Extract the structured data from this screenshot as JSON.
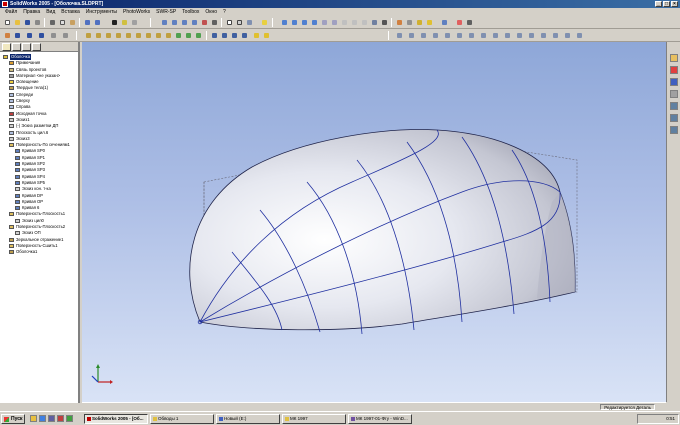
{
  "window": {
    "title": "SolidWorks 2005 - [Оболочка.SLDPRT]",
    "buttons": [
      "_",
      "□",
      "×"
    ]
  },
  "menu": [
    "Файл",
    "Правка",
    "Вид",
    "Вставка",
    "Инструменты",
    "PhotoWorks",
    "SWR-SP",
    "Toolbox",
    "Окно",
    "?"
  ],
  "tree": {
    "items": [
      {
        "label": "Оболочка",
        "indent": 0,
        "icon": "part-icon",
        "selected": true
      },
      {
        "label": "Примечания",
        "indent": 1,
        "icon": "annotations-icon"
      },
      {
        "label": "Связь проектов",
        "indent": 1,
        "icon": "design-binder-icon"
      },
      {
        "label": "Материал <не указан>",
        "indent": 1,
        "icon": "material-icon"
      },
      {
        "label": "Освещение",
        "indent": 1,
        "icon": "lighting-icon"
      },
      {
        "label": "Твердые тела(1)",
        "indent": 1,
        "icon": "solid-bodies-icon"
      },
      {
        "label": "Спереди",
        "indent": 1,
        "icon": "plane-icon"
      },
      {
        "label": "Сверху",
        "indent": 1,
        "icon": "plane-icon"
      },
      {
        "label": "Справа",
        "indent": 1,
        "icon": "plane-icon"
      },
      {
        "label": "Исходная точка",
        "indent": 1,
        "icon": "origin-icon"
      },
      {
        "label": "Эскиз1",
        "indent": 1,
        "icon": "sketch-icon"
      },
      {
        "label": "(-) Эскиз разметки ДП",
        "indent": 1,
        "icon": "sketch-icon"
      },
      {
        "label": "Плоскость цил.6",
        "indent": 1,
        "icon": "plane-icon"
      },
      {
        "label": "Эскиз3",
        "indent": 1,
        "icon": "sketch-icon"
      },
      {
        "label": "Поверхность-По сечениям1",
        "indent": 1,
        "icon": "surface-loft-icon"
      },
      {
        "label": "Кривая SP0",
        "indent": 2,
        "icon": "curve-icon"
      },
      {
        "label": "Кривая SP1",
        "indent": 2,
        "icon": "curve-icon"
      },
      {
        "label": "Кривая SP2",
        "indent": 2,
        "icon": "curve-icon"
      },
      {
        "label": "Кривая SP3",
        "indent": 2,
        "icon": "curve-icon"
      },
      {
        "label": "Кривая SP4",
        "indent": 2,
        "icon": "curve-icon"
      },
      {
        "label": "Кривая SP5",
        "indent": 2,
        "icon": "curve-icon"
      },
      {
        "label": "Эскиз кон. т-ка",
        "indent": 2,
        "icon": "sketch-icon"
      },
      {
        "label": "Кривая DP",
        "indent": 2,
        "icon": "curve-icon"
      },
      {
        "label": "Кривая OP",
        "indent": 2,
        "icon": "curve-icon"
      },
      {
        "label": "Кривая 6",
        "indent": 2,
        "icon": "curve-icon"
      },
      {
        "label": "Поверхность-Плоскость1",
        "indent": 1,
        "icon": "surface-plane-icon"
      },
      {
        "label": "Эскиз цил0",
        "indent": 2,
        "icon": "sketch-icon"
      },
      {
        "label": "Поверхность-Плоскость2",
        "indent": 1,
        "icon": "surface-plane-icon"
      },
      {
        "label": "Эскиз ОП",
        "indent": 2,
        "icon": "sketch-icon"
      },
      {
        "label": "Зеркальное отражение1",
        "indent": 1,
        "icon": "mirror-icon"
      },
      {
        "label": "Поверхность-Сшить1",
        "indent": 1,
        "icon": "surface-knit-icon"
      },
      {
        "label": "Оболочка1",
        "indent": 1,
        "icon": "shell-icon"
      }
    ]
  },
  "status": {
    "mode": "Редактируется Деталь"
  },
  "taskbar": {
    "start": "Пуск",
    "tasks": [
      {
        "label": "SolidWorks 2005 - [Об...",
        "active": true,
        "icon_color": "#c00000"
      },
      {
        "label": "Обводы 1",
        "active": false,
        "icon_color": "#e0c040"
      },
      {
        "label": "Новый (E:)",
        "active": false,
        "icon_color": "#4060c0"
      },
      {
        "label": "МК 1997",
        "active": false,
        "icon_color": "#e0c040"
      },
      {
        "label": "МК 1997-01-Фгу - WinD...",
        "active": false,
        "icon_color": "#7050a0"
      }
    ],
    "clock": "0:51"
  },
  "colors": {
    "title_start": "#0a246a",
    "title_end": "#3a6ea5",
    "viewport_top": "#8ea7d8",
    "viewport_bottom": "#d9e3f6",
    "curve": "#2030a0"
  }
}
